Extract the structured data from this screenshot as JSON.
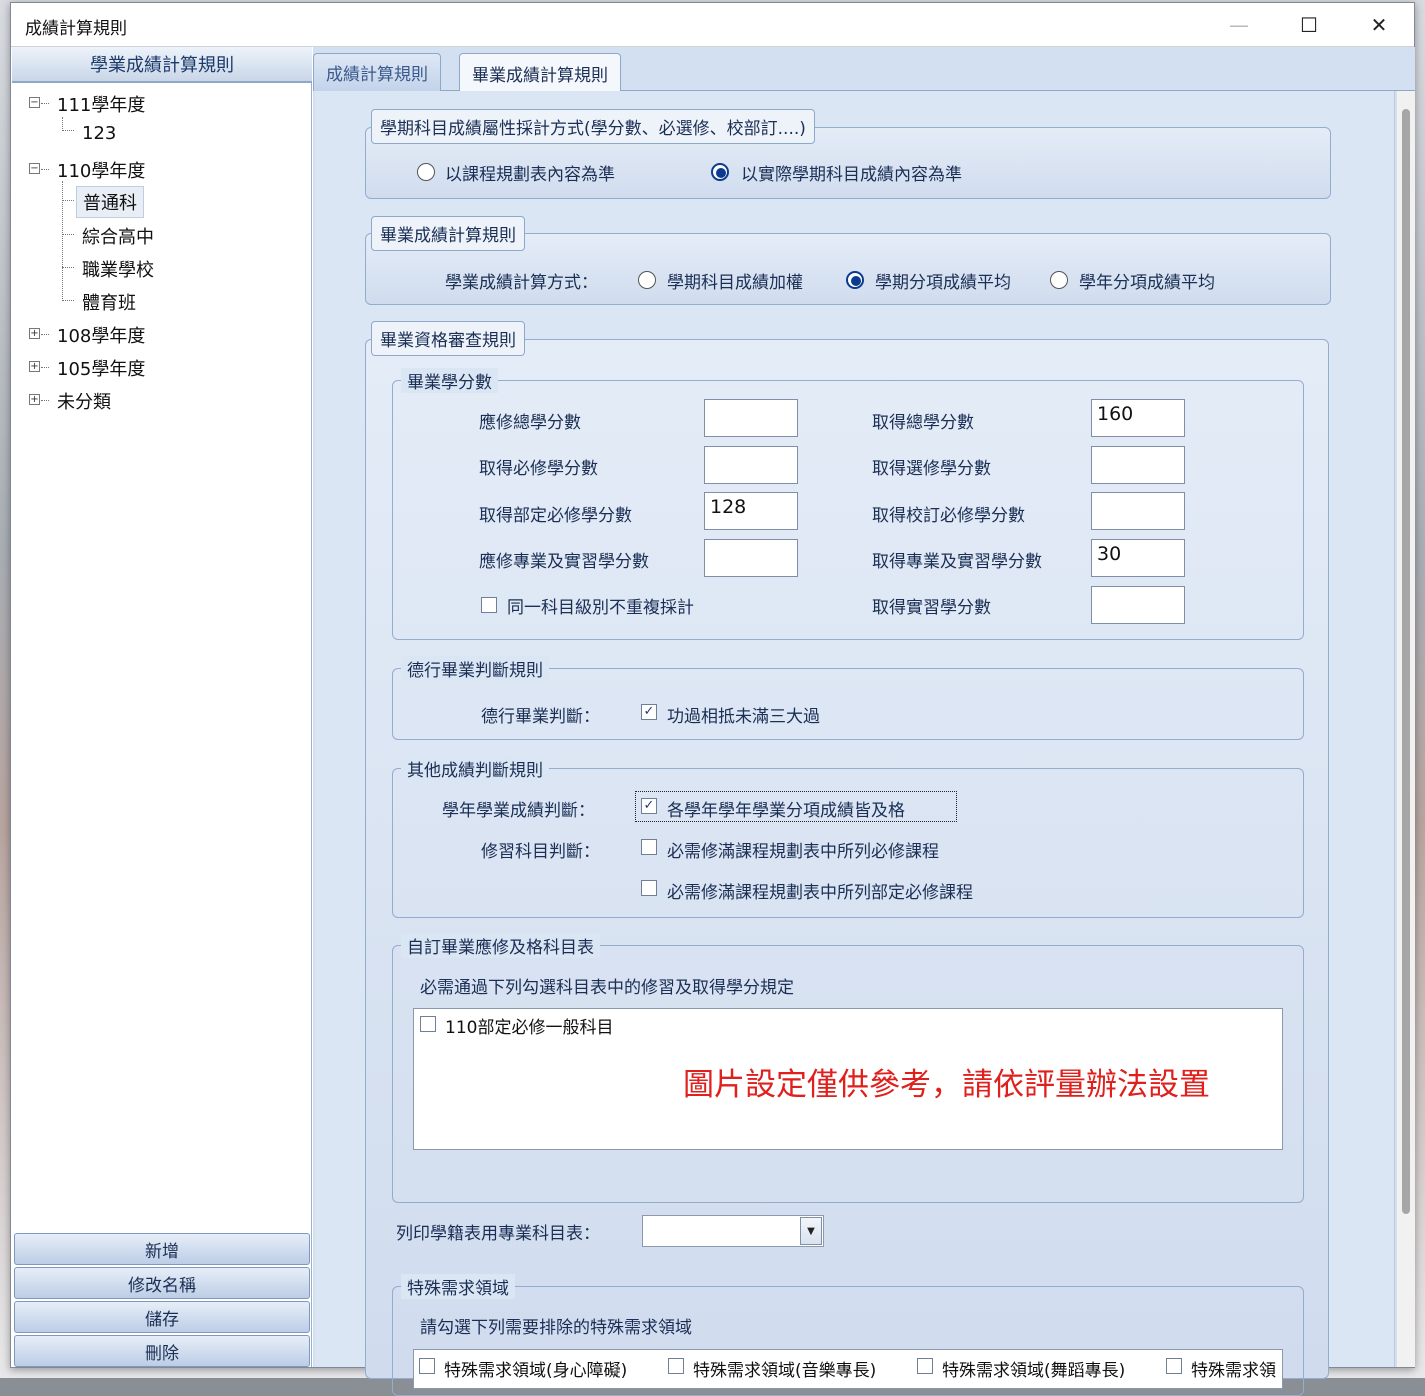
{
  "window": {
    "title": "成績計算規則",
    "minimize": "—",
    "maximize": "☐",
    "close": "✕"
  },
  "sidebar": {
    "header": "學業成績計算規則",
    "tree": [
      {
        "label": "111學年度",
        "expanded": true,
        "children": [
          "123"
        ]
      },
      {
        "label": "110學年度",
        "expanded": true,
        "children": [
          "普通科",
          "綜合高中",
          "職業學校",
          "體育班"
        ]
      },
      {
        "label": "108學年度",
        "expanded": false,
        "children": []
      },
      {
        "label": "105學年度",
        "expanded": false,
        "children": []
      },
      {
        "label": "未分類",
        "expanded": false,
        "children": []
      }
    ],
    "selected": "普通科",
    "buttons": {
      "add": "新增",
      "rename": "修改名稱",
      "save": "儲存",
      "delete": "刪除"
    }
  },
  "tabs": [
    {
      "label": "成績計算規則",
      "active": false
    },
    {
      "label": "畢業成績計算規則",
      "active": true
    }
  ],
  "semester_group": {
    "title": "學期科目成績屬性採計方式(學分數、必選修、校部訂....)",
    "options": [
      {
        "label": "以課程規劃表內容為準",
        "checked": false
      },
      {
        "label": "以實際學期科目成績內容為準",
        "checked": true
      }
    ]
  },
  "grad_calc_group": {
    "title": "畢業成績計算規則",
    "method_label": "學業成績計算方式：",
    "options": [
      {
        "label": "學期科目成績加權",
        "checked": false
      },
      {
        "label": "學期分項成績平均",
        "checked": true
      },
      {
        "label": "學年分項成績平均",
        "checked": false
      }
    ]
  },
  "grad_review_group": {
    "title": "畢業資格審查規則",
    "credits": {
      "title": "畢業學分數",
      "fields_left": [
        {
          "label": "應修總學分數",
          "value": ""
        },
        {
          "label": "取得必修學分數",
          "value": ""
        },
        {
          "label": "取得部定必修學分數",
          "value": "128"
        },
        {
          "label": "應修專業及實習學分數",
          "value": ""
        }
      ],
      "fields_right": [
        {
          "label": "取得總學分數",
          "value": "160"
        },
        {
          "label": "取得選修學分數",
          "value": ""
        },
        {
          "label": "取得校訂必修學分數",
          "value": ""
        },
        {
          "label": "取得專業及實習學分數",
          "value": "30"
        },
        {
          "label": "取得實習學分數",
          "value": ""
        }
      ],
      "no_repeat_label": "同一科目級別不重複採計",
      "no_repeat_checked": false
    },
    "conduct": {
      "title": "德行畢業判斷規則",
      "label": "德行畢業判斷：",
      "option": "功過相抵未滿三大過",
      "checked": true
    },
    "other": {
      "title": "其他成績判斷規則",
      "year_label": "學年學業成績判斷：",
      "year_option": "各學年學年學業分項成績皆及格",
      "year_checked": true,
      "course_label": "修習科目判斷：",
      "course_options": [
        {
          "label": "必需修滿課程規劃表中所列必修課程",
          "checked": false
        },
        {
          "label": "必需修滿課程規劃表中所列部定必修課程",
          "checked": false
        }
      ]
    },
    "custom": {
      "title": "自訂畢業應修及格科目表",
      "desc": "必需通過下列勾選科目表中的修習及取得學分規定",
      "items": [
        {
          "label": "110部定必修一般科目",
          "checked": false
        }
      ],
      "note": "圖片設定僅供參考，請依評量辦法設置"
    },
    "print_label": "列印學籍表用專業科目表：",
    "print_value": "",
    "special": {
      "title": "特殊需求領域",
      "desc": "請勾選下列需要排除的特殊需求領域",
      "items": [
        "特殊需求領域(身心障礙)",
        "特殊需求領域(音樂專長)",
        "特殊需求領域(舞蹈專長)",
        "特殊需求領"
      ]
    }
  },
  "colors": {
    "accent": "#0b3a8e",
    "panel": "#dbe6f4",
    "note": "#e0201c"
  }
}
